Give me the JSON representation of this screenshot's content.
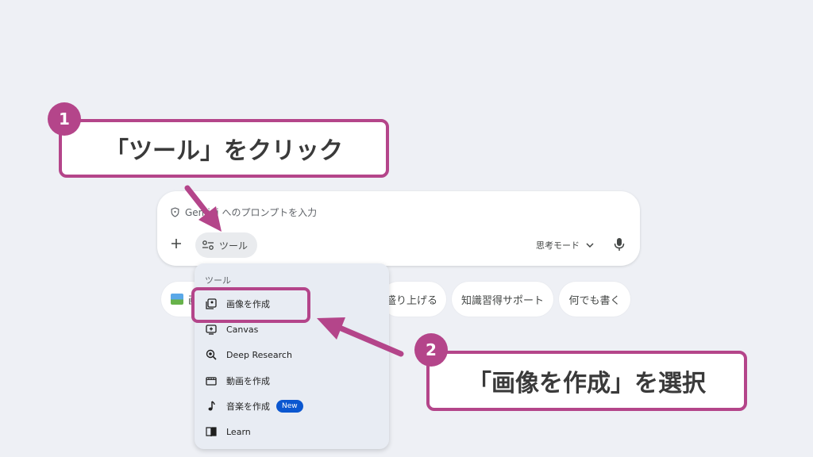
{
  "prompt": {
    "placeholder": "Gemini へのプロンプトを入力",
    "tools_label": "ツール",
    "mode_label": "思考モード"
  },
  "suggestions": [
    {
      "label": "画"
    },
    {
      "label": "盛り上げる"
    },
    {
      "label": "知識習得サポート"
    },
    {
      "label": "何でも書く"
    }
  ],
  "tools_menu": {
    "header": "ツール",
    "items": [
      {
        "label": "画像を作成",
        "icon": "image-create-icon"
      },
      {
        "label": "Canvas",
        "icon": "canvas-icon"
      },
      {
        "label": "Deep Research",
        "icon": "deep-research-icon"
      },
      {
        "label": "動画を作成",
        "icon": "video-icon"
      },
      {
        "label": "音楽を作成",
        "icon": "music-note-icon",
        "badge": "New"
      },
      {
        "label": "Learn",
        "icon": "book-icon"
      }
    ]
  },
  "annotations": {
    "step1_number": "1",
    "step1_text": "「ツール」をクリック",
    "step2_number": "2",
    "step2_text": "「画像を作成」を選択",
    "accent_color": "#b4458a"
  }
}
